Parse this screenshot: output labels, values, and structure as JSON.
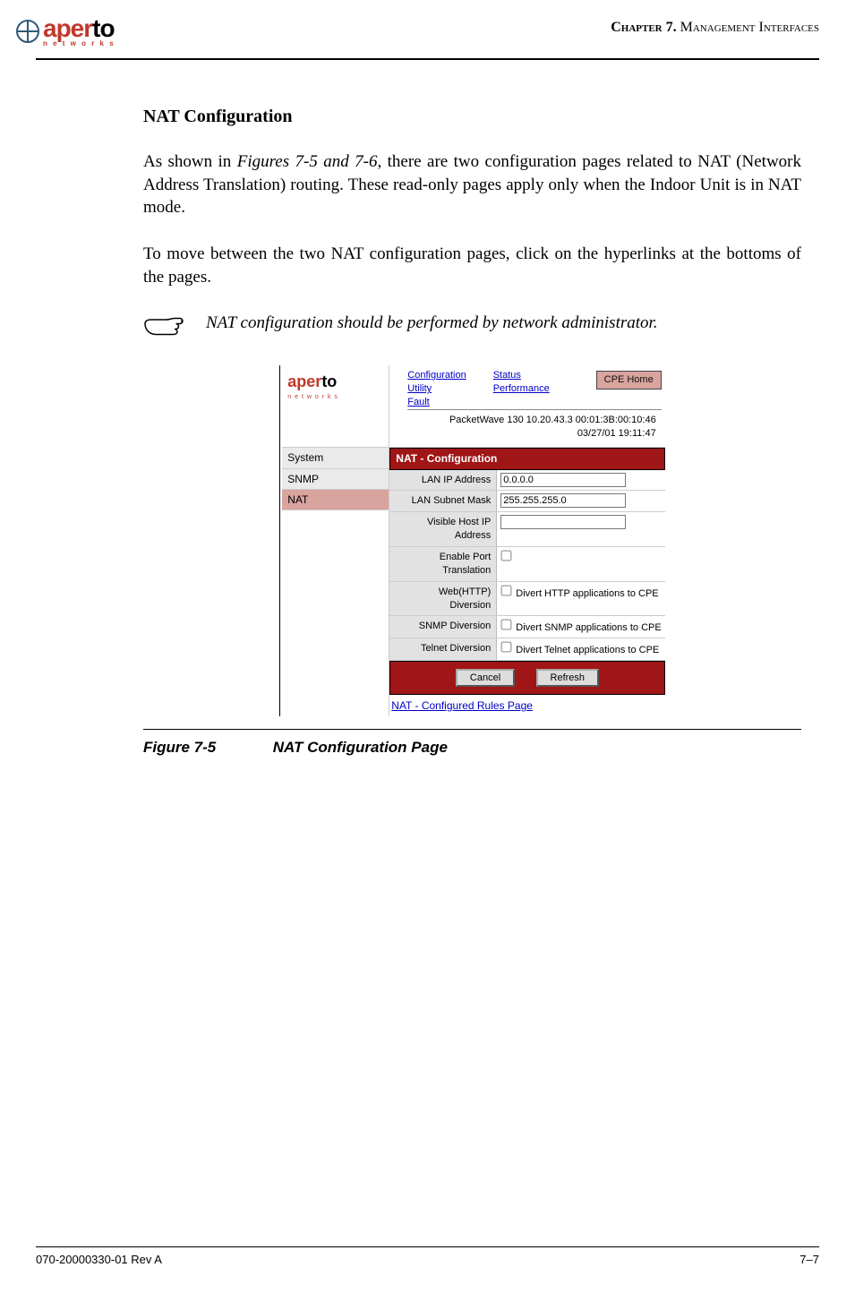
{
  "header": {
    "brand1": "aper",
    "brand2": "to",
    "brand_sub": "n e t w o r k s",
    "chapter_prefix": "Chapter 7.  ",
    "chapter_title_rest": "Management Interfaces"
  },
  "body": {
    "section_title": "NAT Configuration",
    "para1_pre": "As shown in ",
    "para1_ref": "Figures 7-5 and 7-6",
    "para1_post": ", there are two configuration pages related to NAT (Network Address Translation) routing. These read-only pages apply only when the Indoor Unit is in NAT mode.",
    "para2": "To move between the two NAT configuration pages, click on the hyperlinks at the bottoms of the pages.",
    "note": "NAT configuration should be performed by network administrator."
  },
  "screenshot": {
    "logo": {
      "brand1": "aper",
      "brand2": "to",
      "sub": "n e t w o r k s"
    },
    "topnav_col1": [
      "Configuration",
      "Utility",
      "Fault"
    ],
    "topnav_col2": [
      "Status",
      "Performance"
    ],
    "cpe_home": "CPE Home",
    "info_line1": "PacketWave 130    10.20.43.3    00:01:3B:00:10:46",
    "info_line2": "03/27/01    19:11:47",
    "side": [
      "System",
      "SNMP",
      "NAT"
    ],
    "side_selected_index": 2,
    "panel_title": "NAT - Configuration",
    "rows": [
      {
        "label": "LAN IP Address",
        "type": "text",
        "value": "0.0.0.0"
      },
      {
        "label": "LAN Subnet Mask",
        "type": "text",
        "value": "255.255.255.0"
      },
      {
        "label": "Visible Host IP Address",
        "type": "text",
        "value": ""
      },
      {
        "label": "Enable Port Translation",
        "type": "check",
        "text": ""
      },
      {
        "label": "Web(HTTP) Diversion",
        "type": "check",
        "text": "Divert HTTP applications to CPE"
      },
      {
        "label": "SNMP Diversion",
        "type": "check",
        "text": "Divert SNMP applications to CPE"
      },
      {
        "label": "Telnet Diversion",
        "type": "check",
        "text": "Divert Telnet applications to CPE"
      }
    ],
    "buttons": {
      "cancel": "Cancel",
      "refresh": "Refresh"
    },
    "rules_link": "NAT - Configured Rules Page"
  },
  "figure": {
    "number": "Figure 7-5",
    "title": "NAT Configuration Page"
  },
  "footer": {
    "doc_id": "070-20000330-01 Rev A",
    "page_no": "7–7"
  }
}
